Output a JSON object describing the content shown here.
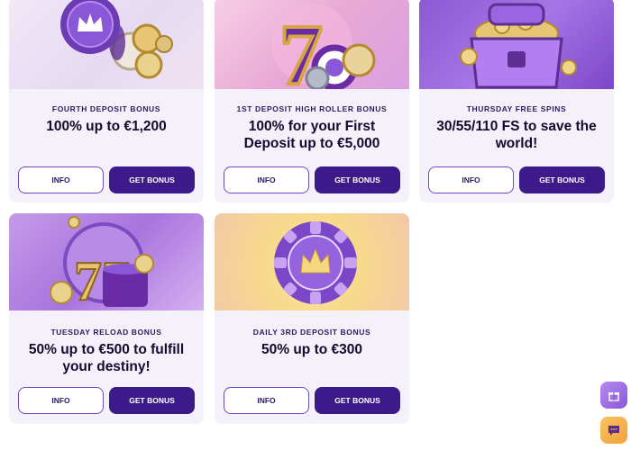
{
  "promotions": [
    {
      "kicker": "FOURTH DEPOSIT BONUS",
      "title": "100% up to €1,200",
      "info_label": "INFO",
      "bonus_label": "GET BONUS"
    },
    {
      "kicker": "1ST DEPOSIT HIGH ROLLER BONUS",
      "title": "100% for your First Deposit up to €5,000",
      "info_label": "INFO",
      "bonus_label": "GET BONUS"
    },
    {
      "kicker": "THURSDAY FREE SPINS",
      "title": "30/55/110 FS to save the world!",
      "info_label": "INFO",
      "bonus_label": "GET BONUS"
    },
    {
      "kicker": "TUESDAY RELOAD BONUS",
      "title": "50% up to €500 to fulfill your destiny!",
      "info_label": "INFO",
      "bonus_label": "GET BONUS"
    },
    {
      "kicker": "DAILY 3RD DEPOSIT BONUS",
      "title": "50% up to €300",
      "info_label": "INFO",
      "bonus_label": "GET BONUS"
    }
  ],
  "art": {
    "p1_badge": "crown-badge-with-coins",
    "p2_symbol": "7",
    "p3_object": "treasure-chest",
    "p4_symbol": "77",
    "p5_object": "casino-chip-crown"
  },
  "fabs": {
    "top_icon": "gift-icon",
    "bottom_icon": "chat-icon"
  },
  "colors": {
    "primary": "#3d1a8a",
    "card_bg": "#f4f1fb",
    "text_dark": "#14092e",
    "accent_orange": "#f3a33a"
  }
}
